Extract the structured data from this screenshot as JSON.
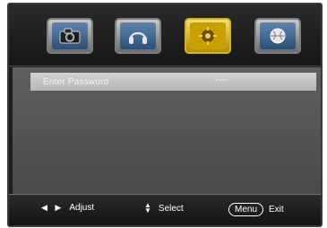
{
  "tabs": [
    {
      "name": "picture",
      "icon": "camera-icon"
    },
    {
      "name": "audio",
      "icon": "headphones-icon"
    },
    {
      "name": "setup",
      "icon": "gear-icon",
      "selected": true
    },
    {
      "name": "globe",
      "icon": "globe-icon"
    }
  ],
  "main": {
    "selected_item": {
      "label": "Enter Password",
      "value": "----"
    }
  },
  "footer": {
    "adjust_label": "Adjust",
    "select_label": "Select",
    "menu_key": "Menu",
    "exit_label": "Exit"
  },
  "colors": {
    "highlight_row": "#c6c6c6",
    "selected_tab": "#d7b31c"
  }
}
